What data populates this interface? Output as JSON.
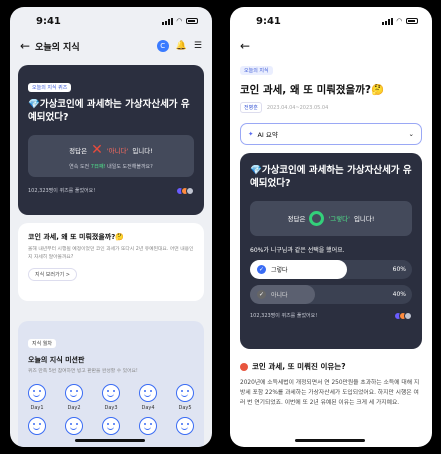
{
  "status": {
    "time": "9:41"
  },
  "left": {
    "header": {
      "title": "오늘의 지식",
      "badge": "C"
    },
    "quiz_card": {
      "tag": "오늘의 지식 퀴즈",
      "title": "💎가상코인에 과세하는 가상자산세가 유예되었다?",
      "answer_prefix": "정답은",
      "answer_value": "'아니다'",
      "answer_suffix": "입니다!",
      "streak_prefix": "연속 도전",
      "streak_count": "7日째!",
      "streak_suffix": "내일도 도전해볼까요?",
      "participants": "102,323명이 퀴즈를 풀었어요!"
    },
    "article_card": {
      "title": "코인 과세, 왜 또 미뤄졌을까?🤔",
      "body": "올해 내년부터 시행될 예정이었던 코인 과세가 또다시 2년 유예된대요. 어떤 내용인지 자세히 알아볼까요?",
      "button": "지식 보러가기 >"
    },
    "mission_card": {
      "tag": "지식 월차",
      "title": "오늘의 지식 미션판",
      "subtitle": "퀴즈 만족 5번 참여하면 빙고 판판을 완성할 수 있어요!",
      "days": [
        "Day1",
        "Day2",
        "Day3",
        "Day4",
        "Day5"
      ]
    }
  },
  "right": {
    "tag": "오늘의 지식",
    "title": "코인 과세, 왜 또 미뤄졌을까?🤔",
    "meta_tag": "전병훈",
    "meta_date": "2023.04.04~2023.05.04",
    "ai_label": "AI 요약",
    "quiz": {
      "title": "💎가상코인에 과세하는 가상자산세가 유예되었다?",
      "answer_prefix": "정답은",
      "answer_value": "'그렇다'",
      "answer_suffix": "입니다!",
      "poll_title": "60%가 니구님과 같은 선택을 했어요.",
      "options": [
        {
          "label": "그렇다",
          "percent": "60%",
          "share": 0.6
        },
        {
          "label": "아니다",
          "percent": "40%",
          "share": 0.4
        }
      ],
      "participants": "102,323명이 퀴즈를 풀었어요!"
    },
    "section_title": "코인 과세, 또 미뤄진 이유는?",
    "section_body": "2020년에 소득세법이 개정되면서 연 250만원을 초과하는 소득에 대해 지방세 포함 22%를 과세하는 가상자산세가 도입되었어요. 하지만 시행은 여러 번 연기되었죠. 이번에 또 2년 유예된 이유는 크게 세 가지예요."
  }
}
